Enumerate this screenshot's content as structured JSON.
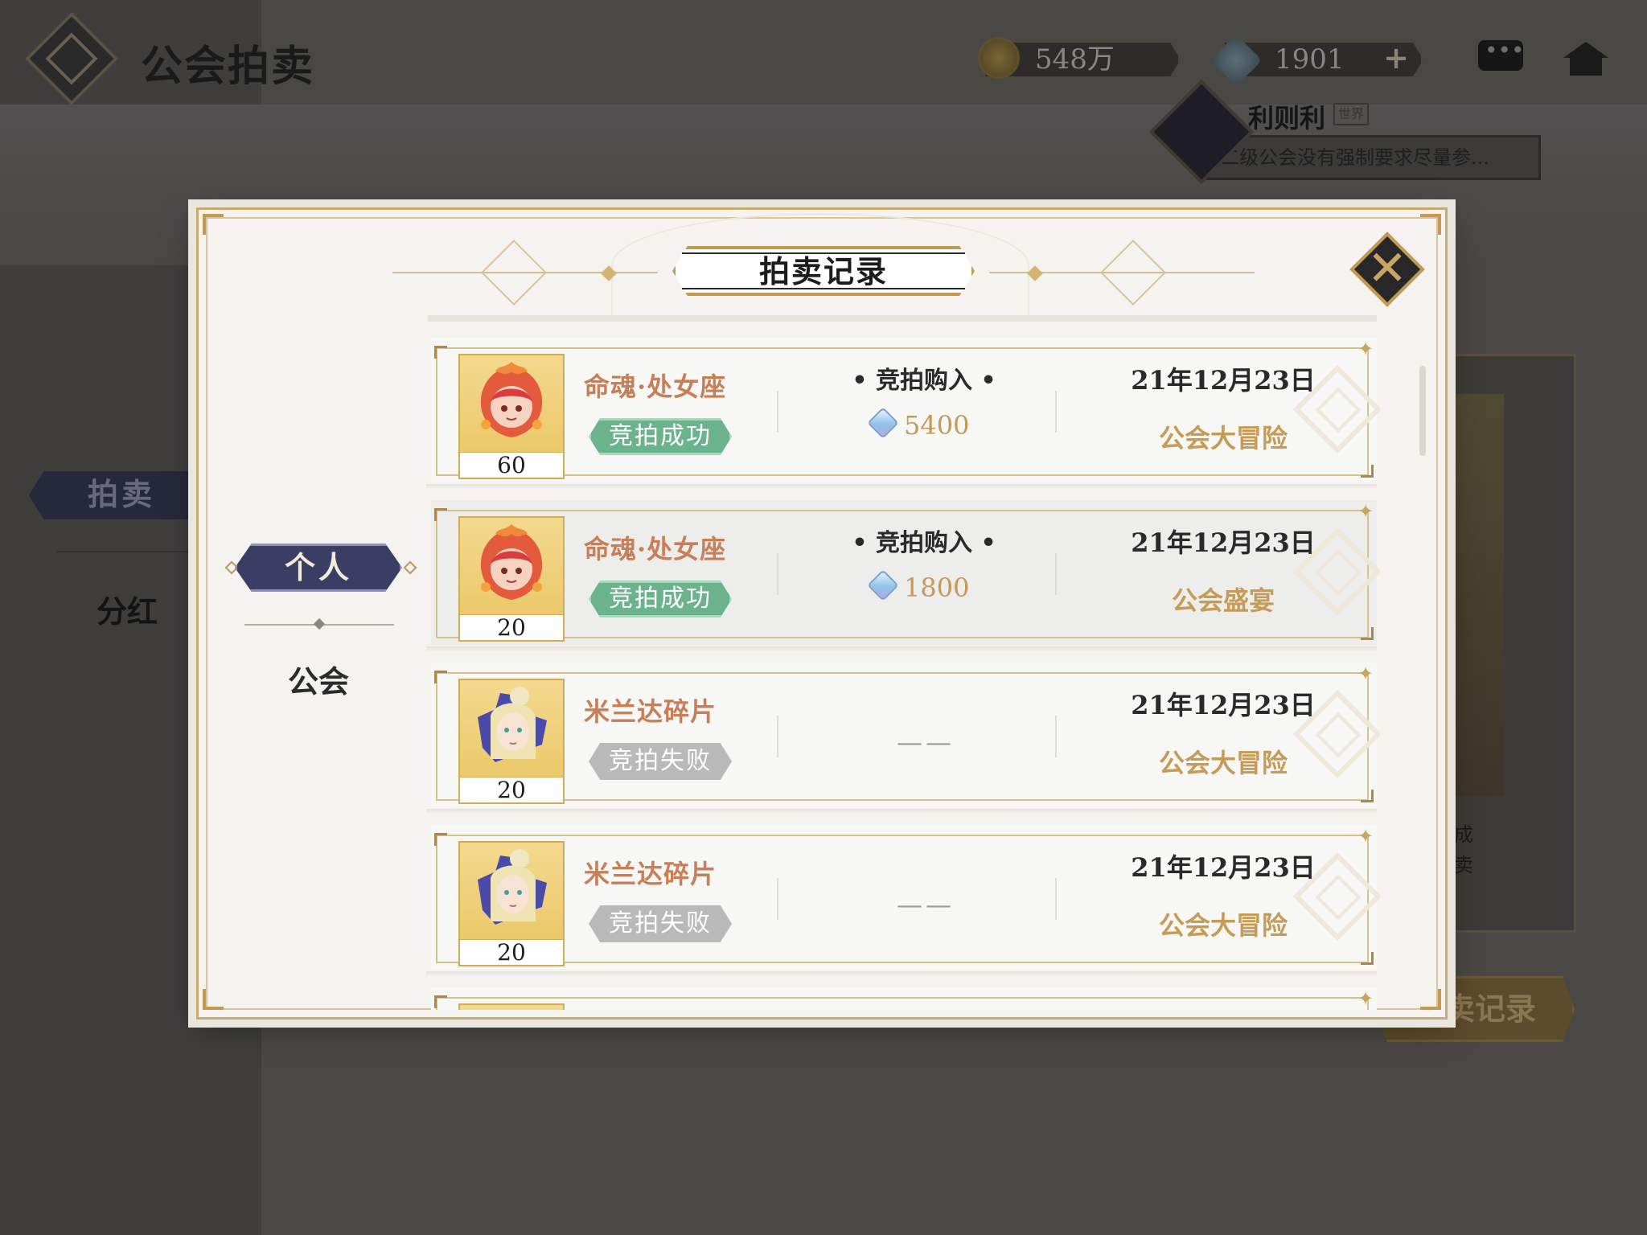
{
  "screen": {
    "title": "公会拍卖",
    "currency_gold": "548万",
    "currency_gem": "1901",
    "plus": "+",
    "chat": {
      "user": "利则利",
      "tag": "世界",
      "message": "二级公会没有强制要求尽量参..."
    },
    "bg_tabs": {
      "auction": "拍卖",
      "dividend": "分红"
    },
    "bg_card_lines": [
      "合成",
      "拍卖"
    ],
    "bg_record_button": "拍卖记录"
  },
  "modal": {
    "title": "拍卖记录",
    "close": "✕",
    "tabs": {
      "personal": "个人",
      "guild": "公会"
    }
  },
  "colors": {
    "accent_gold": "#c49a52",
    "success_green": "#6ab38d",
    "fail_grey": "#b9b9b9",
    "item_name": "#c87e56",
    "tab_active": "#3a3e64"
  },
  "records": [
    {
      "item": "命魂·处女座",
      "icon": "red-spirit-avatar",
      "qty": "60",
      "status": "竞拍成功",
      "status_type": "success",
      "buy_label": "• 竞拍购入 •",
      "price": "5400",
      "date": "21年12月23日",
      "source": "公会大冒险"
    },
    {
      "item": "命魂·处女座",
      "icon": "red-spirit-avatar",
      "qty": "20",
      "status": "竞拍成功",
      "status_type": "success",
      "buy_label": "• 竞拍购入 •",
      "price": "1800",
      "date": "21年12月23日",
      "source": "公会盛宴"
    },
    {
      "item": "米兰达碎片",
      "icon": "miranda-fragment-avatar",
      "qty": "20",
      "status": "竞拍失败",
      "status_type": "fail",
      "no_price": "——",
      "date": "21年12月23日",
      "source": "公会大冒险"
    },
    {
      "item": "米兰达碎片",
      "icon": "miranda-fragment-avatar",
      "qty": "20",
      "status": "竞拍失败",
      "status_type": "fail",
      "no_price": "——",
      "date": "21年12月23日",
      "source": "公会大冒险"
    }
  ]
}
